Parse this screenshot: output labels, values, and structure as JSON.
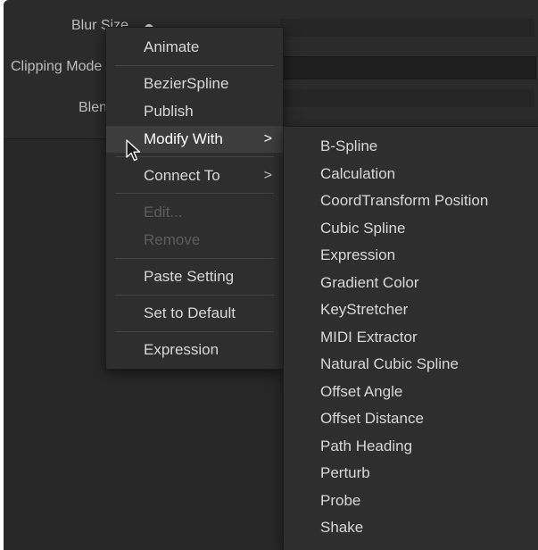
{
  "params": {
    "blur_size": "Blur Size",
    "clipping_mode": "Clipping Mode",
    "blend": "Blend"
  },
  "context_menu": {
    "items": [
      {
        "label": "Animate"
      },
      {
        "label": "BezierSpline"
      },
      {
        "label": "Publish"
      },
      {
        "label": "Modify With"
      },
      {
        "label": "Connect To"
      },
      {
        "label": "Edit..."
      },
      {
        "label": "Remove"
      },
      {
        "label": "Paste Setting"
      },
      {
        "label": "Set to Default"
      },
      {
        "label": "Expression"
      }
    ],
    "chevron": ">"
  },
  "submenu": {
    "items": [
      {
        "label": "B-Spline"
      },
      {
        "label": "Calculation"
      },
      {
        "label": "CoordTransform Position"
      },
      {
        "label": "Cubic Spline"
      },
      {
        "label": "Expression"
      },
      {
        "label": "Gradient Color"
      },
      {
        "label": "KeyStretcher"
      },
      {
        "label": "MIDI Extractor"
      },
      {
        "label": "Natural Cubic Spline"
      },
      {
        "label": "Offset Angle"
      },
      {
        "label": "Offset Distance"
      },
      {
        "label": "Path Heading"
      },
      {
        "label": "Perturb"
      },
      {
        "label": "Probe"
      },
      {
        "label": "Shake"
      }
    ]
  },
  "icons": {
    "cursor": "arrow-pointer-icon",
    "submenu_arrow": "chevron-right-icon"
  },
  "colors": {
    "background": "#282828",
    "menu_background": "#2e2e2e",
    "highlight": "#3d3d3d",
    "text": "#d8d8d8",
    "disabled_text": "#5d5d5d"
  }
}
